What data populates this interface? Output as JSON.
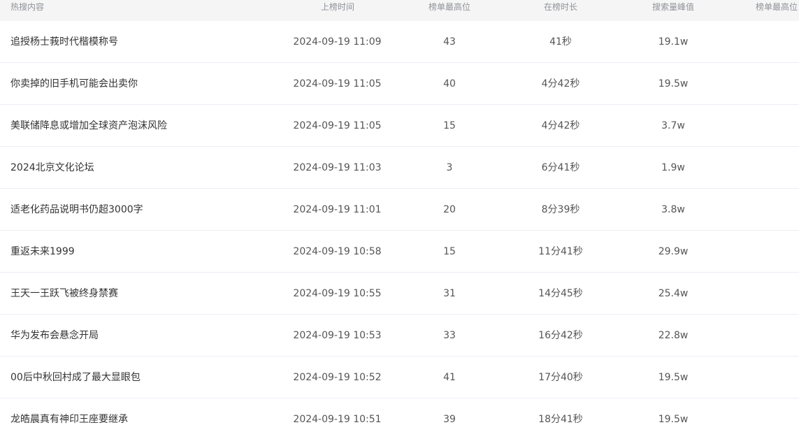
{
  "table": {
    "headers": {
      "title": "热搜内容",
      "time": "上榜时间",
      "rank": "榜单最高位",
      "duration": "在榜时长",
      "peak": "搜索量峰值",
      "extra": "榜单最高位"
    },
    "rows": [
      {
        "title": "追授杨士莪时代楷模称号",
        "time": "2024-09-19 11:09",
        "rank": "43",
        "duration": "41秒",
        "peak": "19.1w"
      },
      {
        "title": "你卖掉的旧手机可能会出卖你",
        "time": "2024-09-19 11:05",
        "rank": "40",
        "duration": "4分42秒",
        "peak": "19.5w"
      },
      {
        "title": "美联储降息或增加全球资产泡沫风险",
        "time": "2024-09-19 11:05",
        "rank": "15",
        "duration": "4分42秒",
        "peak": "3.7w"
      },
      {
        "title": "2024北京文化论坛",
        "time": "2024-09-19 11:03",
        "rank": "3",
        "duration": "6分41秒",
        "peak": "1.9w"
      },
      {
        "title": "适老化药品说明书仍超3000字",
        "time": "2024-09-19 11:01",
        "rank": "20",
        "duration": "8分39秒",
        "peak": "3.8w"
      },
      {
        "title": "重返未来1999",
        "time": "2024-09-19 10:58",
        "rank": "15",
        "duration": "11分41秒",
        "peak": "29.9w"
      },
      {
        "title": "王天一王跃飞被终身禁赛",
        "time": "2024-09-19 10:55",
        "rank": "31",
        "duration": "14分45秒",
        "peak": "25.4w"
      },
      {
        "title": "华为发布会悬念开局",
        "time": "2024-09-19 10:53",
        "rank": "33",
        "duration": "16分42秒",
        "peak": "22.8w"
      },
      {
        "title": "00后中秋回村成了最大显眼包",
        "time": "2024-09-19 10:52",
        "rank": "41",
        "duration": "17分40秒",
        "peak": "19.5w"
      },
      {
        "title": "龙皓晨真有神印王座要继承",
        "time": "2024-09-19 10:51",
        "rank": "39",
        "duration": "18分41秒",
        "peak": "19.5w"
      }
    ]
  }
}
